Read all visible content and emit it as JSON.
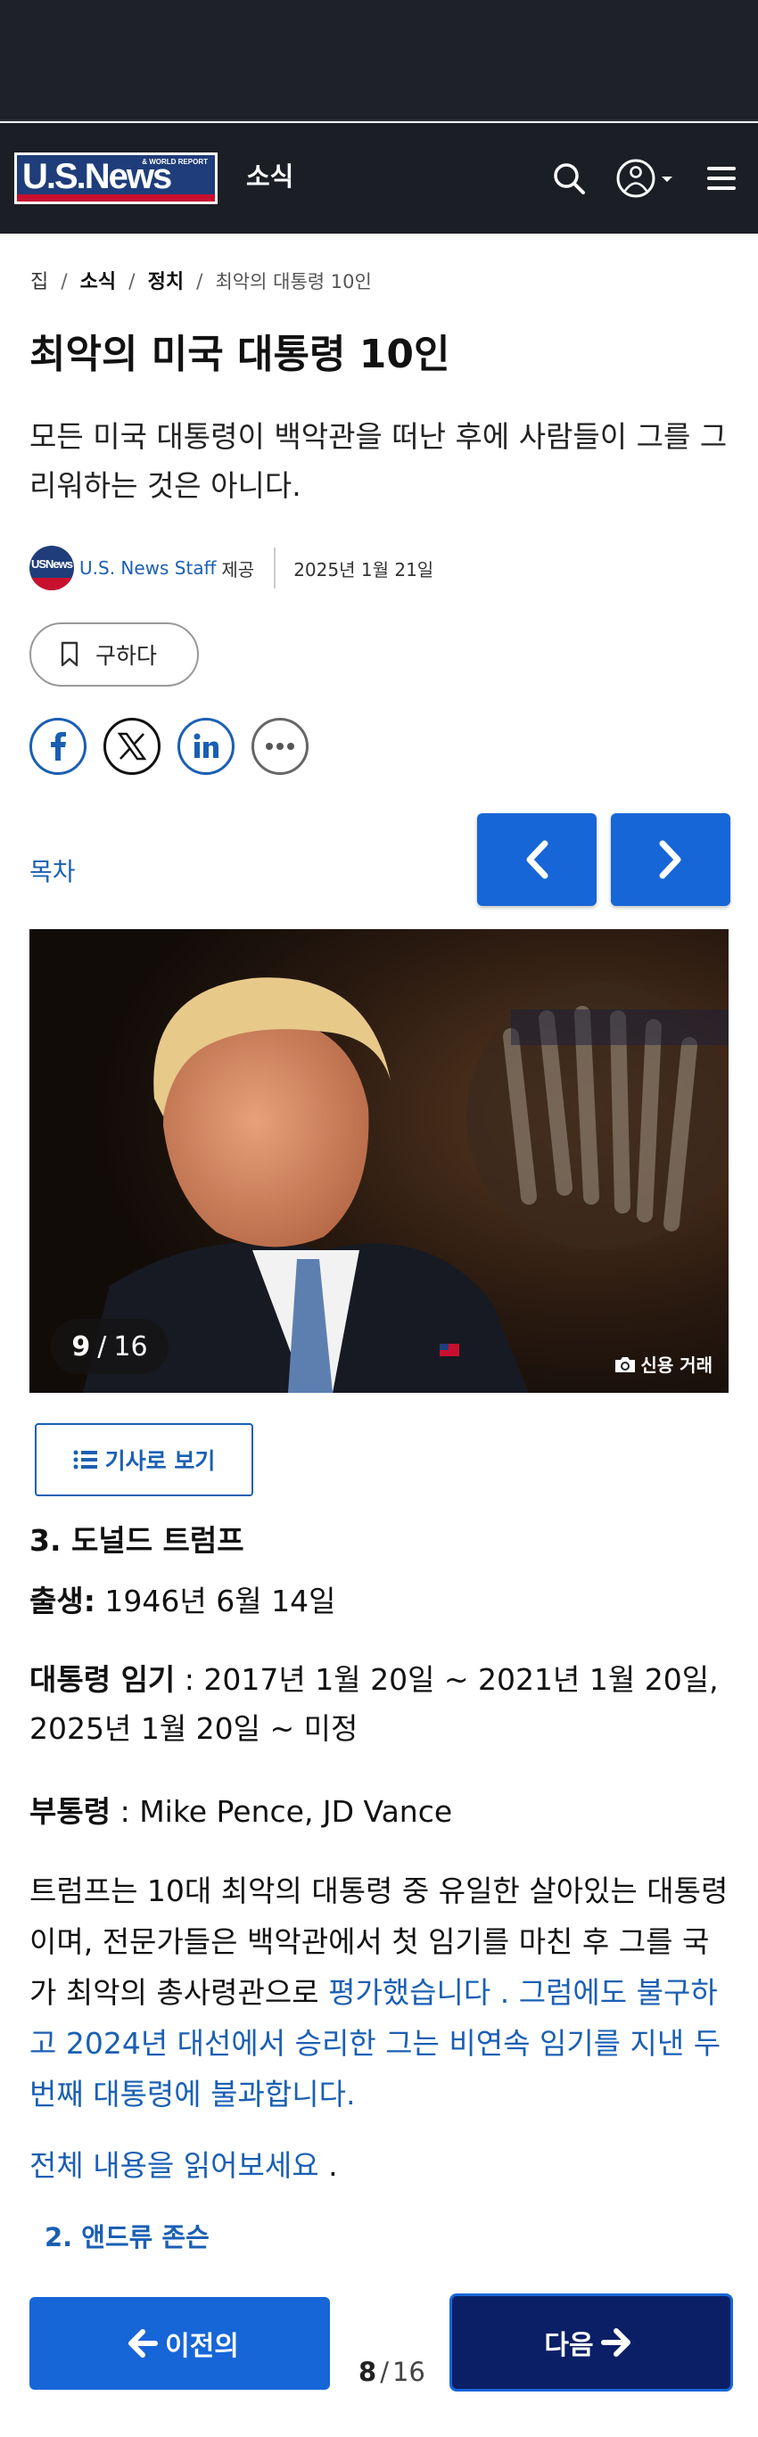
{
  "header": {
    "logo_text": "U.S.News",
    "logo_subtext": "& WORLD REPORT",
    "section": "소식"
  },
  "breadcrumb": {
    "home": "집",
    "news": "소식",
    "politics": "정치",
    "current": "최악의 대통령 10인",
    "separator": "/"
  },
  "article": {
    "title": "최악의 미국 대통령 10인",
    "subtitle": "모든 미국 대통령이 백악관을 떠난 후에 사람들이 그를 그리워하는 것은 아니다.",
    "author": "U.S. News Staff",
    "provided_by": "제공",
    "date": "2025년 1월 21일",
    "avatar_text": "USNews"
  },
  "actions": {
    "save_label": "구하다"
  },
  "gallery": {
    "toc_label": "목차",
    "current": "9",
    "total": "16",
    "credit": "신용 거래",
    "view_article_label": "기사로 보기"
  },
  "slide": {
    "heading": "3. 도널드 트럼프",
    "born_label": "출생:",
    "born_value": " 1946년 6월 14일",
    "term_label": "대통령 임기",
    "term_value": " : 2017년 1월 20일 ~ 2021년 1월 20일, 2025년 1월 20일 ~ 미정",
    "vp_label": "부통령",
    "vp_value": " : Mike Pence, JD Vance",
    "body_plain": "트럼프는 10대 최악의 대통령 중 유일한 살아있는 대통령이며, 전문가들은 백악관에서 첫 임기를 마친 후 그를 국가 최악의 총사령관으로 ",
    "body_link": "평가했습니다 . 그럼에도 불구하고 2024년 대선에서 승리한 그는 비연속 임기를 지낸 두 번째 대통령에 불과합니다.",
    "read_more_link": "전체 내용을 읽어보세요",
    "read_more_tail": " .",
    "prev_slide_link": "2. 앤드류 존슨"
  },
  "pagination": {
    "prev_label": "이전의",
    "next_label": "다음",
    "current": "8",
    "separator": "/",
    "total": "16"
  },
  "colors": {
    "brand_blue": "#1766d8",
    "link_blue": "#1a5fb4",
    "navy": "#0a1f66",
    "header_bg": "#1b1e25",
    "logo_red": "#c8102e"
  }
}
